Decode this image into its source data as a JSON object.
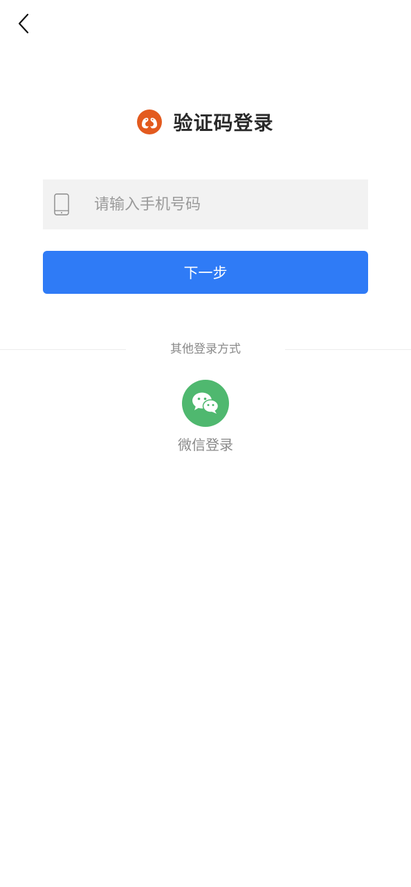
{
  "header": {
    "back_icon": "chevron-left-icon"
  },
  "title_row": {
    "logo_icon": "twin-birds-logo",
    "title": "验证码登录",
    "logo_color": "#e35a1e"
  },
  "phone_field": {
    "icon": "mobile-phone-icon",
    "placeholder": "请输入手机号码",
    "value": ""
  },
  "next_button": {
    "label": "下一步",
    "color": "#2f7bf6"
  },
  "other_login": {
    "heading": "其他登录方式",
    "wechat": {
      "icon": "wechat-icon",
      "label": "微信登录",
      "color": "#4fb86f"
    }
  }
}
